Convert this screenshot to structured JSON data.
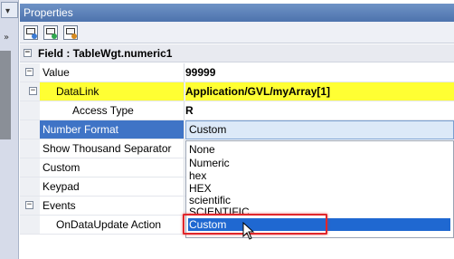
{
  "panel": {
    "title": "Properties",
    "field_header": "Field : TableWgt.numeric1"
  },
  "toolbar": {
    "buttons": [
      "properties-view-icon",
      "add-property-icon",
      "refresh-icon"
    ]
  },
  "rows": [
    {
      "name": "Value",
      "value": "99999",
      "expander": "⊟"
    },
    {
      "name": "DataLink",
      "value": "Application/GVL/myArray[1]",
      "expander": "⊟"
    },
    {
      "name": "Access Type",
      "value": "R"
    },
    {
      "name": "Number Format",
      "value": "Custom"
    },
    {
      "name": "Show Thousand Separator",
      "value": ""
    },
    {
      "name": "Custom",
      "value": ""
    },
    {
      "name": "Keypad",
      "value": ""
    },
    {
      "name": "Events",
      "value": "",
      "expander": "⊟"
    },
    {
      "name": "OnDataUpdate Action",
      "value": ""
    }
  ],
  "dropdown": {
    "selected": "Custom",
    "options": [
      "None",
      "Numeric",
      "hex",
      "HEX",
      "scientific",
      "SCIENTIFIC",
      "Custom"
    ],
    "highlighted_index": 6
  },
  "colors": {
    "datalink_bg": "#ffff33",
    "selection_blue": "#3f74c6",
    "list_selected": "#1f68d1",
    "callout_red": "#e0262b"
  }
}
